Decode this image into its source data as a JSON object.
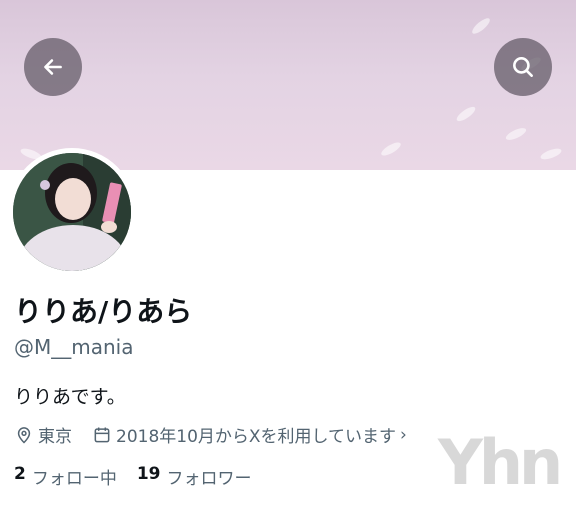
{
  "profile": {
    "display_name": "りりあ/りあら",
    "handle": "@M__mania",
    "bio": "りりあです。",
    "location": "東京",
    "joined": "2018年10月からXを利用しています",
    "following_count": "2",
    "following_label": "フォロー中",
    "followers_count": "19",
    "followers_label": "フォロワー"
  },
  "header": {
    "back_icon": "arrow-left-icon",
    "search_icon": "search-icon"
  },
  "watermark": {
    "text": "Yhn"
  },
  "colors": {
    "banner": "#e3d3e3",
    "button_bg": "#605864",
    "text_primary": "#0f1419",
    "text_secondary": "#536471"
  }
}
